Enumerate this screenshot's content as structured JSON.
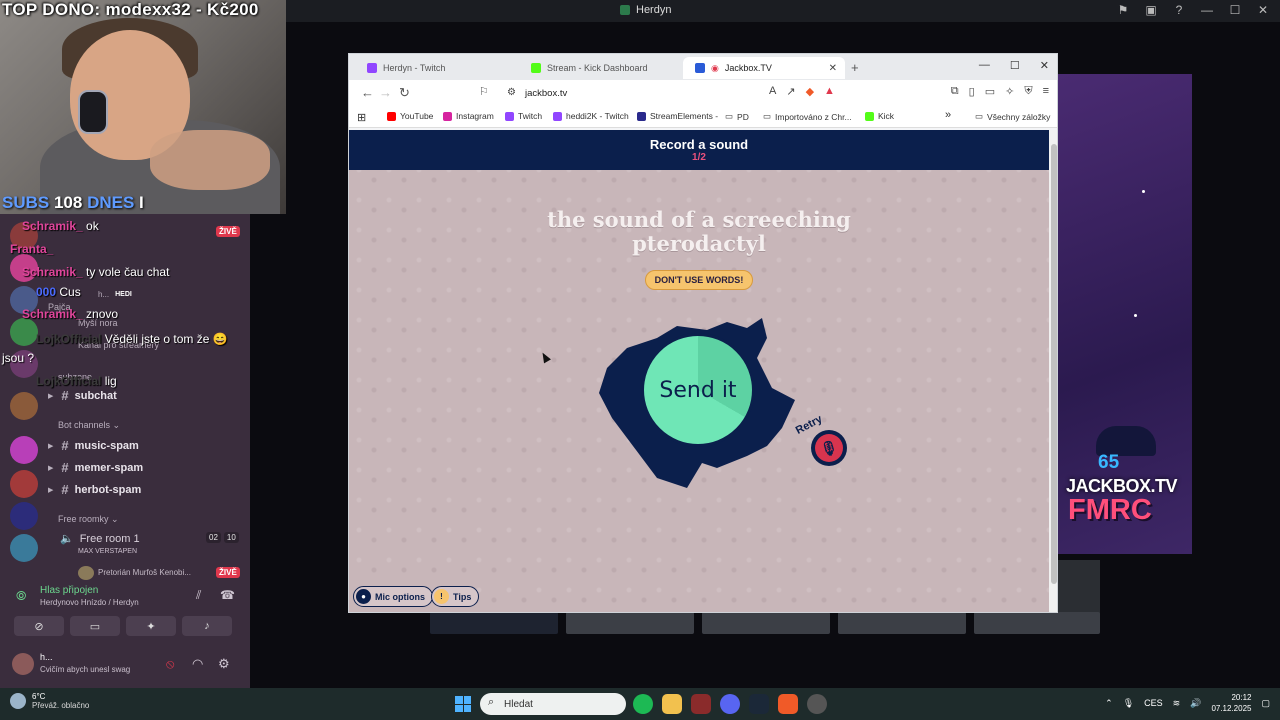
{
  "host": {
    "title": "Herdyn",
    "controls": [
      "—",
      "☐",
      "✕"
    ]
  },
  "webcam": {
    "top_dono": "TOP DONO: modexx32 - Kč200",
    "subs_label": "SUBS",
    "subs_value": "108",
    "dnes_label": "DNES",
    "dnes_value": "I"
  },
  "chat": [
    {
      "user": "Schramik_",
      "text": "ok"
    },
    {
      "user": "Franta_",
      "text": ""
    },
    {
      "user": "Schramik_",
      "text": "ty vole čau chat"
    },
    {
      "user": "000",
      "text": "Cus"
    },
    {
      "user": "Schramik_",
      "text": "znovo"
    },
    {
      "user": "LojkOfficial",
      "text": "Věděli jste o tom že"
    },
    {
      "user": "jsou",
      "text": "?"
    },
    {
      "user": "LojkOfficial",
      "text": "lig"
    }
  ],
  "sidebar": {
    "voice_items": [
      "Pajča",
      "h...",
      "HEDI",
      "Myší nora",
      "Kanál pro streamery",
      "subzone"
    ],
    "channels": [
      {
        "label": "subchat"
      },
      {
        "label": "music-spam"
      },
      {
        "label": "memer-spam"
      },
      {
        "label": "herbot-spam"
      }
    ],
    "categories": {
      "bot": "Bot channels",
      "free": "Free roomky"
    },
    "free_room": {
      "label": "Free room 1",
      "count_a": "02",
      "count_b": "10",
      "sub": "MAX VERSTAPEN"
    },
    "live_label": "ŽIVĚ",
    "pretorian": "Pretorián Murfoš Kenobi...",
    "voice": {
      "status": "Hlas připojen",
      "location": "Herdynovo Hnízdo / Herdyn"
    },
    "user": {
      "name": "h...",
      "status": "Cvičím abych unesl swag"
    }
  },
  "browser": {
    "tabs": [
      {
        "label": "Herdyn - Twitch",
        "color": "#9146ff"
      },
      {
        "label": "Stream - Kick Dashboard",
        "color": "#53fc18"
      },
      {
        "label": "Jackbox.TV",
        "color": "#2a5bd7"
      }
    ],
    "url": "jackbox.tv",
    "bookmarks": [
      {
        "label": "YouTube",
        "color": "#ff0000"
      },
      {
        "label": "Instagram",
        "color": "#d6249f"
      },
      {
        "label": "Twitch",
        "color": "#9146ff"
      },
      {
        "label": "heddi2K - Twitch",
        "color": "#9146ff"
      },
      {
        "label": "StreamElements -",
        "color": "#2a2a8c"
      },
      {
        "label": "PD",
        "color": "#666666"
      },
      {
        "label": "Importováno z Chr...",
        "color": "#666666"
      },
      {
        "label": "Kick",
        "color": "#53fc18"
      }
    ],
    "bookmarks_more": "»",
    "bookmarks_all": "Všechny záložky"
  },
  "jackbox": {
    "header_title": "Record a sound",
    "progress": "1/2",
    "prompt": "the sound of a screeching pterodactyl",
    "rule_pill": "DON'T USE WORDS!",
    "send_label": "Send it",
    "retry_label": "Retry",
    "mic_options": "Mic options",
    "tips": "Tips",
    "accent": "#0b1f4c",
    "send_color": "#6fe6b6"
  },
  "bg_jackbox": {
    "number": "65",
    "brand": "JACKBOX.TV",
    "code": "FMRC"
  },
  "taskbar": {
    "temp": "6°C",
    "weather": "Převáž. oblačno",
    "search_placeholder": "Hledat",
    "lang": "CES",
    "time": "20:12",
    "date": "07.12.2025"
  }
}
